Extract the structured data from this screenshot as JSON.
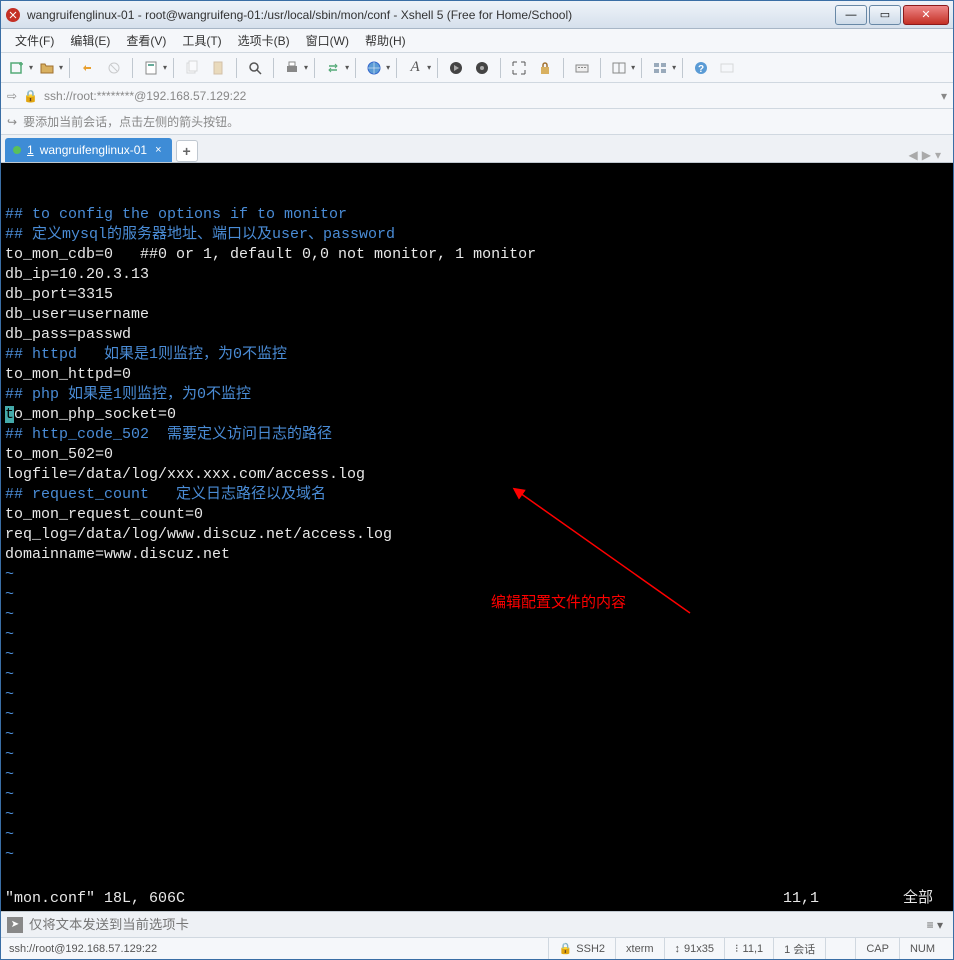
{
  "window": {
    "title": "wangruifenglinux-01 - root@wangruifeng-01:/usr/local/sbin/mon/conf - Xshell 5 (Free for Home/School)"
  },
  "menu": {
    "file": "文件(F)",
    "edit": "编辑(E)",
    "view": "查看(V)",
    "tools": "工具(T)",
    "tabs": "选项卡(B)",
    "window": "窗口(W)",
    "help": "帮助(H)"
  },
  "addressbar": {
    "ssh": "ssh://root:********@192.168.57.129:22"
  },
  "tipbar": {
    "text": "要添加当前会话，点击左侧的箭头按钮。"
  },
  "tab": {
    "index": "1",
    "label": "wangruifenglinux-01"
  },
  "terminal": {
    "lines": [
      {
        "cls": "blue",
        "text": "## to config the options if to monitor"
      },
      {
        "cls": "blue",
        "text": "## 定义mysql的服务器地址、端口以及user、password"
      },
      {
        "cls": "white",
        "text": "to_mon_cdb=0   ##0 or 1, default 0,0 not monitor, 1 monitor"
      },
      {
        "cls": "white",
        "text": "db_ip=10.20.3.13"
      },
      {
        "cls": "white",
        "text": "db_port=3315"
      },
      {
        "cls": "white",
        "text": "db_user=username"
      },
      {
        "cls": "white",
        "text": "db_pass=passwd"
      },
      {
        "cls": "blue",
        "text": "## httpd   如果是1则监控，为0不监控"
      },
      {
        "cls": "white",
        "text": "to_mon_httpd=0"
      },
      {
        "cls": "blue",
        "text": "## php 如果是1则监控，为0不监控"
      },
      {
        "cls": "white",
        "text": "to_mon_php_socket=0",
        "cursor": true
      },
      {
        "cls": "blue",
        "text": "## http_code_502  需要定义访问日志的路径"
      },
      {
        "cls": "white",
        "text": "to_mon_502=0"
      },
      {
        "cls": "white",
        "text": "logfile=/data/log/xxx.xxx.com/access.log"
      },
      {
        "cls": "blue",
        "text": "## request_count   定义日志路径以及域名"
      },
      {
        "cls": "white",
        "text": "to_mon_request_count=0"
      },
      {
        "cls": "white",
        "text": "req_log=/data/log/www.discuz.net/access.log"
      },
      {
        "cls": "white",
        "text": "domainname=www.discuz.net"
      }
    ],
    "tilde_count": 15,
    "status_left": "\"mon.conf\" 18L, 606C",
    "status_pos": "11,1",
    "status_right": "全部"
  },
  "annotation": {
    "text": "编辑配置文件的内容"
  },
  "sendbar": {
    "placeholder": "仅将文本发送到当前选项卡"
  },
  "statusbar": {
    "ssh": "ssh://root@192.168.57.129:22",
    "proto": "SSH2",
    "term": "xterm",
    "size": "91x35",
    "pos": "11,1",
    "sessions": "1 会话",
    "cap": "CAP",
    "num": "NUM"
  }
}
